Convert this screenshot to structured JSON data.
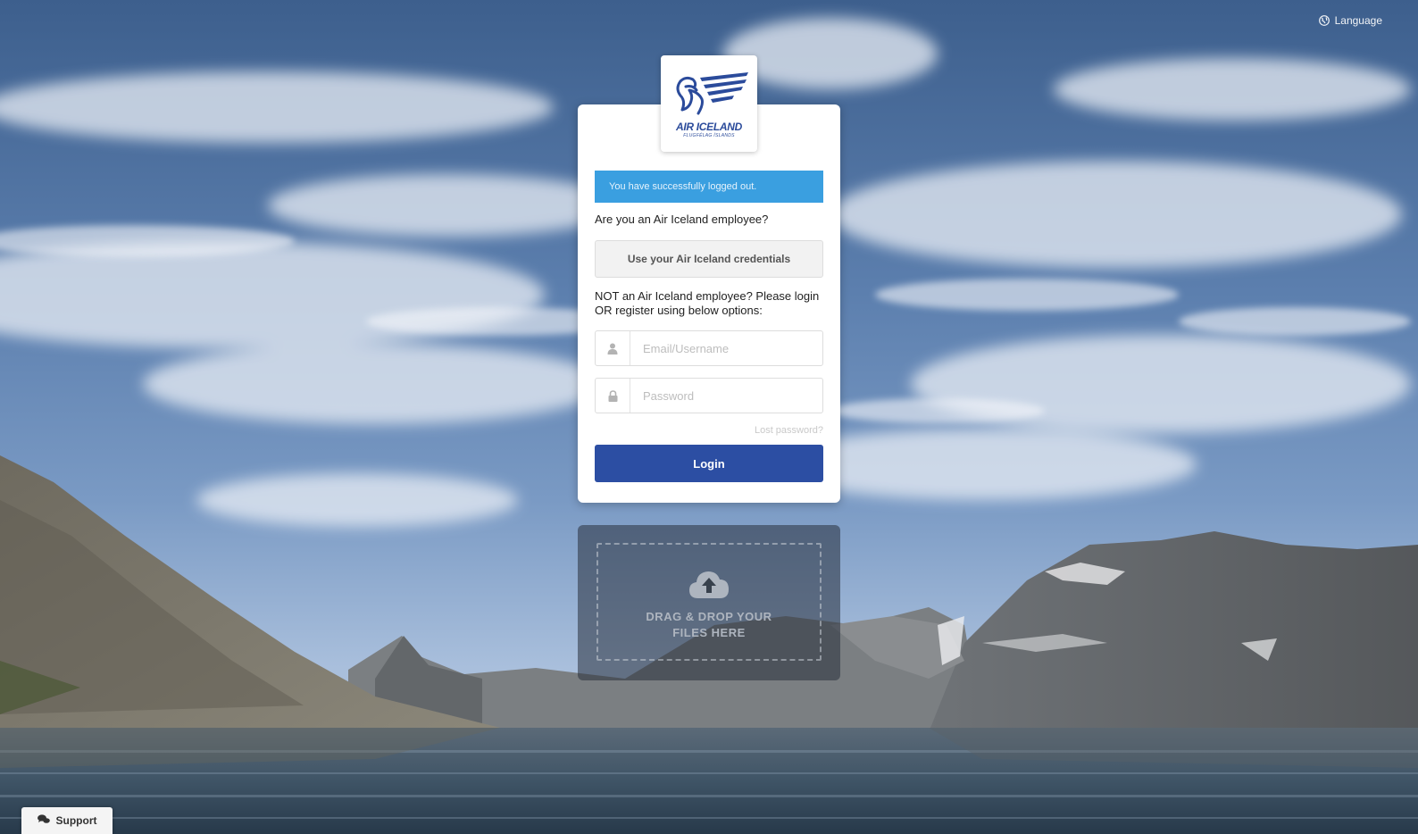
{
  "header": {
    "language_label": "Language",
    "language_icon": "globe-icon"
  },
  "logo": {
    "name": "AIR ICELAND",
    "subtitle": "FLUGFÉLAG ÍSLANDS",
    "brand_color": "#2b4b9b"
  },
  "login": {
    "alert_text": "You have successfully logged out.",
    "employee_question": "Are you an Air Iceland employee?",
    "sso_button_label": "Use your Air Iceland credentials",
    "non_employee_text": "NOT an Air Iceland employee? Please login OR register using below options:",
    "email_placeholder": "Email/Username",
    "email_value": "",
    "password_placeholder": "Password",
    "password_value": "",
    "lost_password_label": "Lost password?",
    "login_button_label": "Login",
    "alert_color": "#3a9fe0",
    "button_color": "#2c4ea3"
  },
  "dropzone": {
    "line1": "DRAG & DROP YOUR",
    "line2": "FILES HERE",
    "icon": "cloud-upload-icon"
  },
  "footer": {
    "support_label": "Support",
    "support_icon": "chat-bubbles-icon"
  }
}
